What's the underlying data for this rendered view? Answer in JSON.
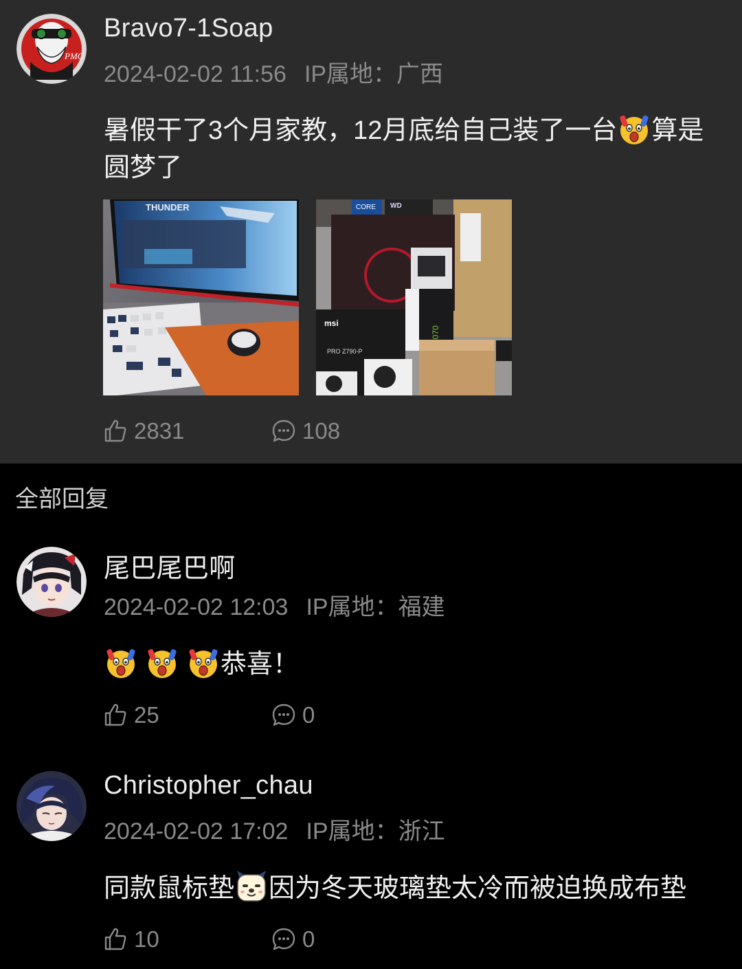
{
  "post": {
    "username": "Bravo7-1Soap",
    "datetime": "2024-02-02 11:56",
    "ip_location": "IP属地：广西",
    "content_part1": "暑假干了3个月家教，12月底给自己装了一台",
    "content_emoji": "shocked-emoji",
    "content_part2": "算是圆梦了",
    "likes": "2831",
    "comments": "108",
    "images": [
      "gaming-setup-photo",
      "pc-parts-boxes-photo"
    ]
  },
  "replies_header": "全部回复",
  "replies": [
    {
      "username": "尾巴尾巴啊",
      "datetime": "2024-02-02 12:03",
      "ip_location": "IP属地：福建",
      "content_text": "恭喜！",
      "likes": "25",
      "comments": "0"
    },
    {
      "username": "Christopher_chau",
      "datetime": "2024-02-02 17:02",
      "ip_location": "IP属地：浙江",
      "content_part1": "同款鼠标垫",
      "content_emoji": "dog-emoji",
      "content_part2": "因为冬天玻璃垫太冷而被迫换成布垫",
      "likes": "10",
      "comments": "0"
    }
  ],
  "colors": {
    "post_bg": "#2b2b2b",
    "page_bg": "#000000",
    "meta_text": "#8a8a8a",
    "main_text": "#ececec"
  }
}
